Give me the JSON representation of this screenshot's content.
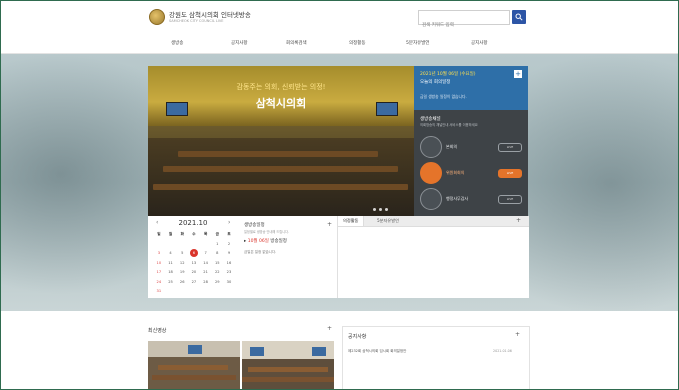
{
  "header": {
    "logo_title": "강원도 삼척시의회 인터넷방송",
    "logo_sub": "SAMCHEOK CITY COUNCIL LIVE",
    "search_placeholder": "검색 키워드 입력"
  },
  "nav": [
    "생방송",
    "공지사항",
    "회의록검색",
    "의정활동",
    "5분자유발언",
    "공지사항"
  ],
  "hero": {
    "slogan": "감동주는 의회, 신뢰받는 의정!",
    "name": "삼척시의회"
  },
  "side_panel": {
    "date": "2021년 10월 06일 (수요일)",
    "status": "오늘의 회의일정",
    "info": "금일 생방송 일정이 없습니다.",
    "section_title": "생방송채널",
    "section_desc": "의회방송의 채널안내 서비스를 이용하세요",
    "items": [
      {
        "label": "본회의",
        "btn": "LIVE",
        "active": false
      },
      {
        "label": "위원회회의",
        "btn": "LIVE",
        "active": true
      },
      {
        "label": "행정사무감사",
        "btn": "LIVE",
        "active": false
      }
    ]
  },
  "calendar": {
    "month": "2021.10",
    "prev": "‹",
    "next": "›",
    "weekdays": [
      "일",
      "월",
      "화",
      "수",
      "목",
      "금",
      "토"
    ],
    "rows": [
      [
        "",
        "",
        "",
        "",
        "",
        "1",
        "2"
      ],
      [
        "3",
        "4",
        "5",
        "6",
        "7",
        "8",
        "9"
      ],
      [
        "10",
        "11",
        "12",
        "13",
        "14",
        "15",
        "16"
      ],
      [
        "17",
        "18",
        "19",
        "20",
        "21",
        "22",
        "23"
      ],
      [
        "24",
        "25",
        "26",
        "27",
        "28",
        "29",
        "30"
      ],
      [
        "31",
        "",
        "",
        "",
        "",
        "",
        ""
      ]
    ],
    "today": "6"
  },
  "schedule": {
    "title": "생방송일정",
    "sub": "일정별로 생방송 안내해 드립니다.",
    "event_date": "10월 06일",
    "event_label": "방송일정",
    "note": "금일은 일정 없습니다.",
    "plus": "+"
  },
  "tabs": {
    "items": [
      "의정활동",
      "5분자유발언"
    ],
    "plus": "+"
  },
  "bottom": {
    "video_title": "최신영상",
    "video_plus": "+",
    "notice_title": "공지사항",
    "notice_plus": "+",
    "notice_item": "제232회 삼척시의회 임시회 회의일정안",
    "notice_date": "2021.01.06"
  }
}
